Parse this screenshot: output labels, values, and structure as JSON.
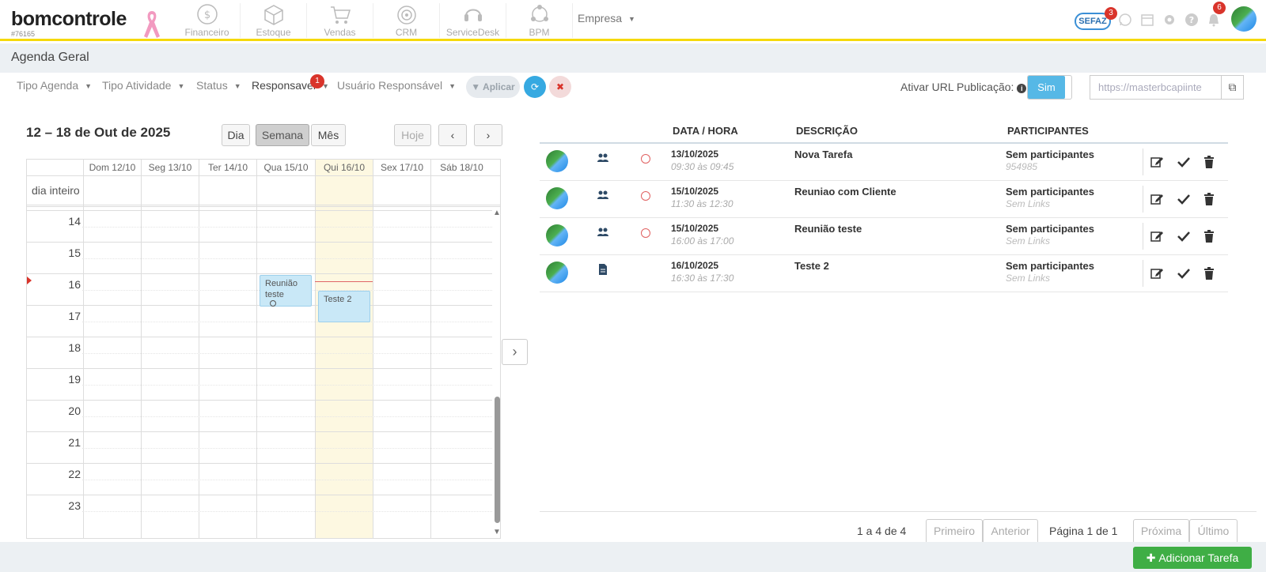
{
  "brand": {
    "name": "bomcontrole",
    "account_id": "#76165"
  },
  "nav": {
    "items": [
      {
        "label": "Financeiro",
        "icon": "dollar-circle-icon"
      },
      {
        "label": "Estoque",
        "icon": "box-icon"
      },
      {
        "label": "Vendas",
        "icon": "cart-icon"
      },
      {
        "label": "CRM",
        "icon": "target-icon"
      },
      {
        "label": "ServiceDesk",
        "icon": "headset-icon"
      },
      {
        "label": "BPM",
        "icon": "network-icon"
      }
    ],
    "empresa": "Empresa"
  },
  "top_icons": {
    "sefaz_label": "SEFAZ",
    "sefaz_badge": "3",
    "notifications_badge": "6"
  },
  "page": {
    "title": "Agenda Geral"
  },
  "filters": {
    "tipo_agenda": "Tipo Agenda",
    "tipo_atividade": "Tipo Atividade",
    "status": "Status",
    "responsavel": "Responsavel",
    "responsavel_badge": "1",
    "usuario_responsavel": "Usuário Responsável",
    "aplicar": "Aplicar",
    "url_label": "Ativar URL Publicação:",
    "toggle_value": "Sim",
    "url_value": "https://masterbcapiinte"
  },
  "calendar": {
    "title": "12 – 18 de Out de 2025",
    "views": {
      "day": "Dia",
      "week": "Semana",
      "month": "Mês"
    },
    "today": "Hoje",
    "days": [
      "Dom 12/10",
      "Seg 13/10",
      "Ter 14/10",
      "Qua 15/10",
      "Qui 16/10",
      "Sex 17/10",
      "Sáb 18/10"
    ],
    "allday_label": "dia inteiro",
    "hours": [
      "14",
      "15",
      "16",
      "17",
      "18",
      "19",
      "20",
      "21",
      "22",
      "23"
    ],
    "events": [
      {
        "title": "Reunião teste",
        "day": "Qua 15/10",
        "start": "16:00",
        "end": "17:00"
      },
      {
        "title": "Teste 2",
        "day": "Qui 16/10",
        "start": "16:30",
        "end": "17:30"
      }
    ]
  },
  "tasks": {
    "headers": {
      "datetime": "DATA / HORA",
      "description": "DESCRIÇÃO",
      "participants": "PARTICIPANTES"
    },
    "rows": [
      {
        "date": "13/10/2025",
        "time": "09:30 às 09:45",
        "description": "Nova Tarefa",
        "participants": "Sem participantes",
        "sub": "954985",
        "type": "users-icon",
        "status": true
      },
      {
        "date": "15/10/2025",
        "time": "11:30 às 12:30",
        "description": "Reuniao com Cliente",
        "participants": "Sem participantes",
        "sub": "Sem Links",
        "type": "users-icon",
        "status": true
      },
      {
        "date": "15/10/2025",
        "time": "16:00 às 17:00",
        "description": "Reunião teste",
        "participants": "Sem participantes",
        "sub": "Sem Links",
        "type": "users-icon",
        "status": true
      },
      {
        "date": "16/10/2025",
        "time": "16:30 às 17:30",
        "description": "Teste 2",
        "participants": "Sem participantes",
        "sub": "Sem Links",
        "type": "document-icon",
        "status": false
      }
    ]
  },
  "pagination": {
    "count": "1 a 4 de 4",
    "first": "Primeiro",
    "prev": "Anterior",
    "page": "Página 1 de 1",
    "next": "Próxima",
    "last": "Último"
  },
  "footer": {
    "add_task": "Adicionar Tarefa"
  },
  "colors": {
    "accent": "#f5d90a",
    "primary": "#36a9e1",
    "success": "#3fae45",
    "danger": "#d9342b"
  }
}
